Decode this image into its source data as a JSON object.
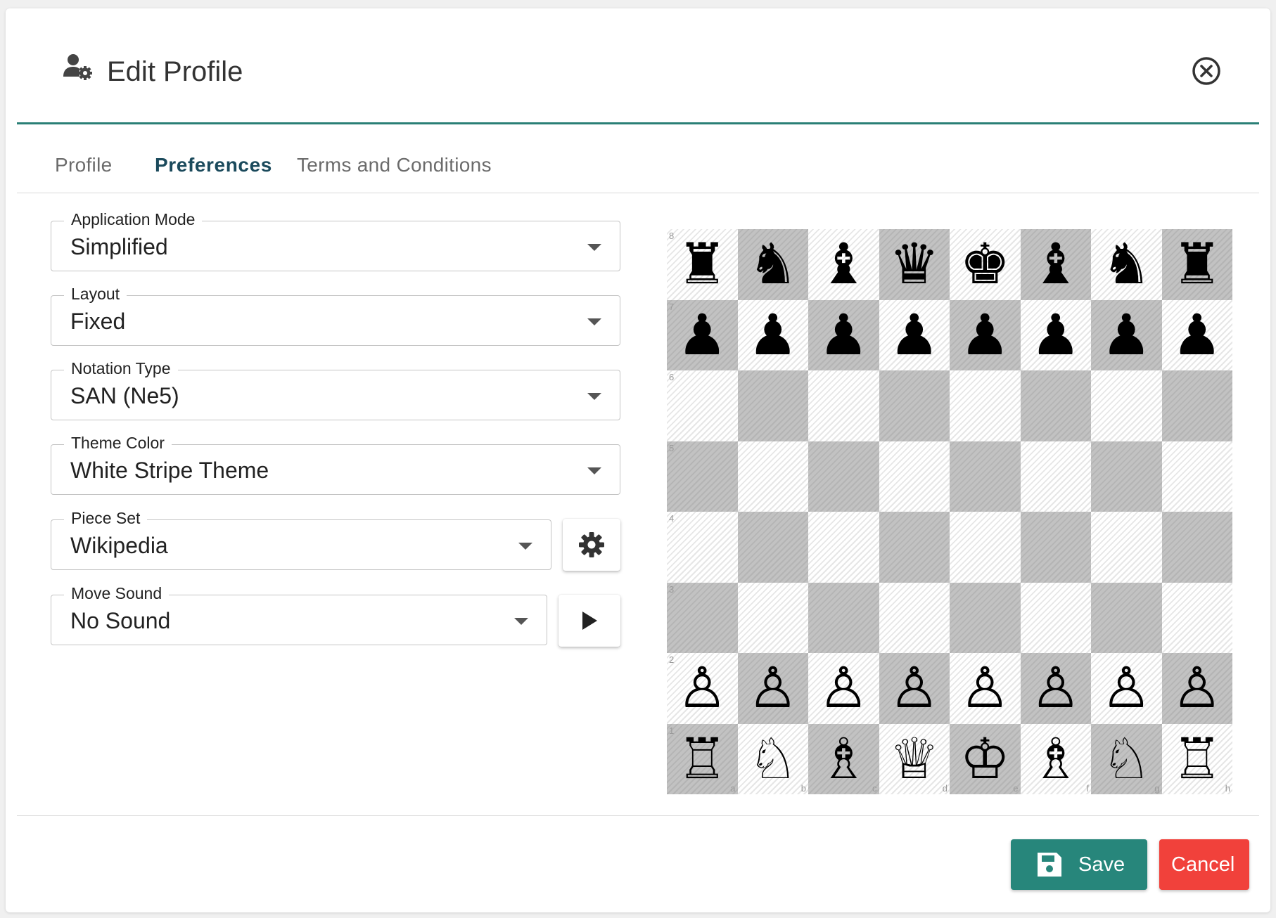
{
  "dialog": {
    "title": "Edit Profile",
    "icons": {
      "title_icon": "user-gear-icon",
      "close_icon": "close-circle-icon"
    }
  },
  "tabs": [
    {
      "label": "Profile",
      "active": false
    },
    {
      "label": "Preferences",
      "active": true
    },
    {
      "label": "Terms and Conditions",
      "active": false
    }
  ],
  "preferences": {
    "application_mode": {
      "label": "Application Mode",
      "value": "Simplified"
    },
    "layout": {
      "label": "Layout",
      "value": "Fixed"
    },
    "notation_type": {
      "label": "Notation Type",
      "value": "SAN (Ne5)"
    },
    "theme_color": {
      "label": "Theme Color",
      "value": "White Stripe Theme"
    },
    "piece_set": {
      "label": "Piece Set",
      "value": "Wikipedia",
      "side_button_icon": "gear-icon"
    },
    "move_sound": {
      "label": "Move Sound",
      "value": "No Sound",
      "side_button_icon": "play-icon"
    }
  },
  "board": {
    "ranks": [
      "8",
      "7",
      "6",
      "5",
      "4",
      "3",
      "2",
      "1"
    ],
    "files": [
      "a",
      "b",
      "c",
      "d",
      "e",
      "f",
      "g",
      "h"
    ],
    "position": [
      [
        "♜",
        "♞",
        "♝",
        "♛",
        "♚",
        "♝",
        "♞",
        "♜"
      ],
      [
        "♟",
        "♟",
        "♟",
        "♟",
        "♟",
        "♟",
        "♟",
        "♟"
      ],
      [
        "",
        "",
        "",
        "",
        "",
        "",
        "",
        ""
      ],
      [
        "",
        "",
        "",
        "",
        "",
        "",
        "",
        ""
      ],
      [
        "",
        "",
        "",
        "",
        "",
        "",
        "",
        ""
      ],
      [
        "",
        "",
        "",
        "",
        "",
        "",
        "",
        ""
      ],
      [
        "♙",
        "♙",
        "♙",
        "♙",
        "♙",
        "♙",
        "♙",
        "♙"
      ],
      [
        "♖",
        "♘",
        "♗",
        "♕",
        "♔",
        "♗",
        "♘",
        "♖"
      ]
    ]
  },
  "footer": {
    "save_label": "Save",
    "save_icon": "floppy-disk-icon",
    "cancel_label": "Cancel"
  },
  "colors": {
    "accent": "#2a7f76",
    "save_button": "#27867b",
    "cancel_button": "#f1413b",
    "active_tab": "#1b4a5c"
  }
}
